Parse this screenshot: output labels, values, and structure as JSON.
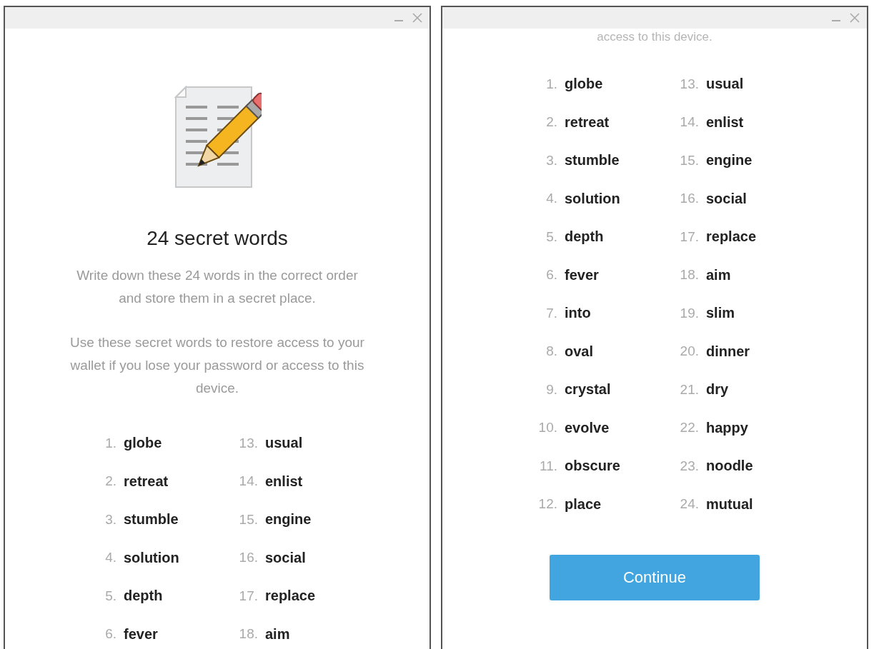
{
  "windows": [
    {
      "kind": "intro",
      "heading": "24 secret words",
      "paragraphs": [
        "Write down these 24 words in the correct order and store them in a secret place.",
        "Use these secret words to restore access to your wallet if you lose your password or access to this device."
      ],
      "columns": [
        [
          {
            "number": "1.",
            "word": "globe"
          },
          {
            "number": "2.",
            "word": "retreat"
          },
          {
            "number": "3.",
            "word": "stumble"
          },
          {
            "number": "4.",
            "word": "solution"
          },
          {
            "number": "5.",
            "word": "depth"
          },
          {
            "number": "6.",
            "word": "fever"
          }
        ],
        [
          {
            "number": "13.",
            "word": "usual"
          },
          {
            "number": "14.",
            "word": "enlist"
          },
          {
            "number": "15.",
            "word": "engine"
          },
          {
            "number": "16.",
            "word": "social"
          },
          {
            "number": "17.",
            "word": "replace"
          },
          {
            "number": "18.",
            "word": "aim"
          }
        ]
      ]
    },
    {
      "kind": "list",
      "caption": "access to this device.",
      "columns": [
        [
          {
            "number": "1.",
            "word": "globe"
          },
          {
            "number": "2.",
            "word": "retreat"
          },
          {
            "number": "3.",
            "word": "stumble"
          },
          {
            "number": "4.",
            "word": "solution"
          },
          {
            "number": "5.",
            "word": "depth"
          },
          {
            "number": "6.",
            "word": "fever"
          },
          {
            "number": "7.",
            "word": "into"
          },
          {
            "number": "8.",
            "word": "oval"
          },
          {
            "number": "9.",
            "word": "crystal"
          },
          {
            "number": "10.",
            "word": "evolve"
          },
          {
            "number": "11.",
            "word": "obscure"
          },
          {
            "number": "12.",
            "word": "place"
          }
        ],
        [
          {
            "number": "13.",
            "word": "usual"
          },
          {
            "number": "14.",
            "word": "enlist"
          },
          {
            "number": "15.",
            "word": "engine"
          },
          {
            "number": "16.",
            "word": "social"
          },
          {
            "number": "17.",
            "word": "replace"
          },
          {
            "number": "18.",
            "word": "aim"
          },
          {
            "number": "19.",
            "word": "slim"
          },
          {
            "number": "20.",
            "word": "dinner"
          },
          {
            "number": "21.",
            "word": "dry"
          },
          {
            "number": "22.",
            "word": "happy"
          },
          {
            "number": "23.",
            "word": "noodle"
          },
          {
            "number": "24.",
            "word": "mutual"
          }
        ]
      ],
      "button": "Continue"
    }
  ]
}
